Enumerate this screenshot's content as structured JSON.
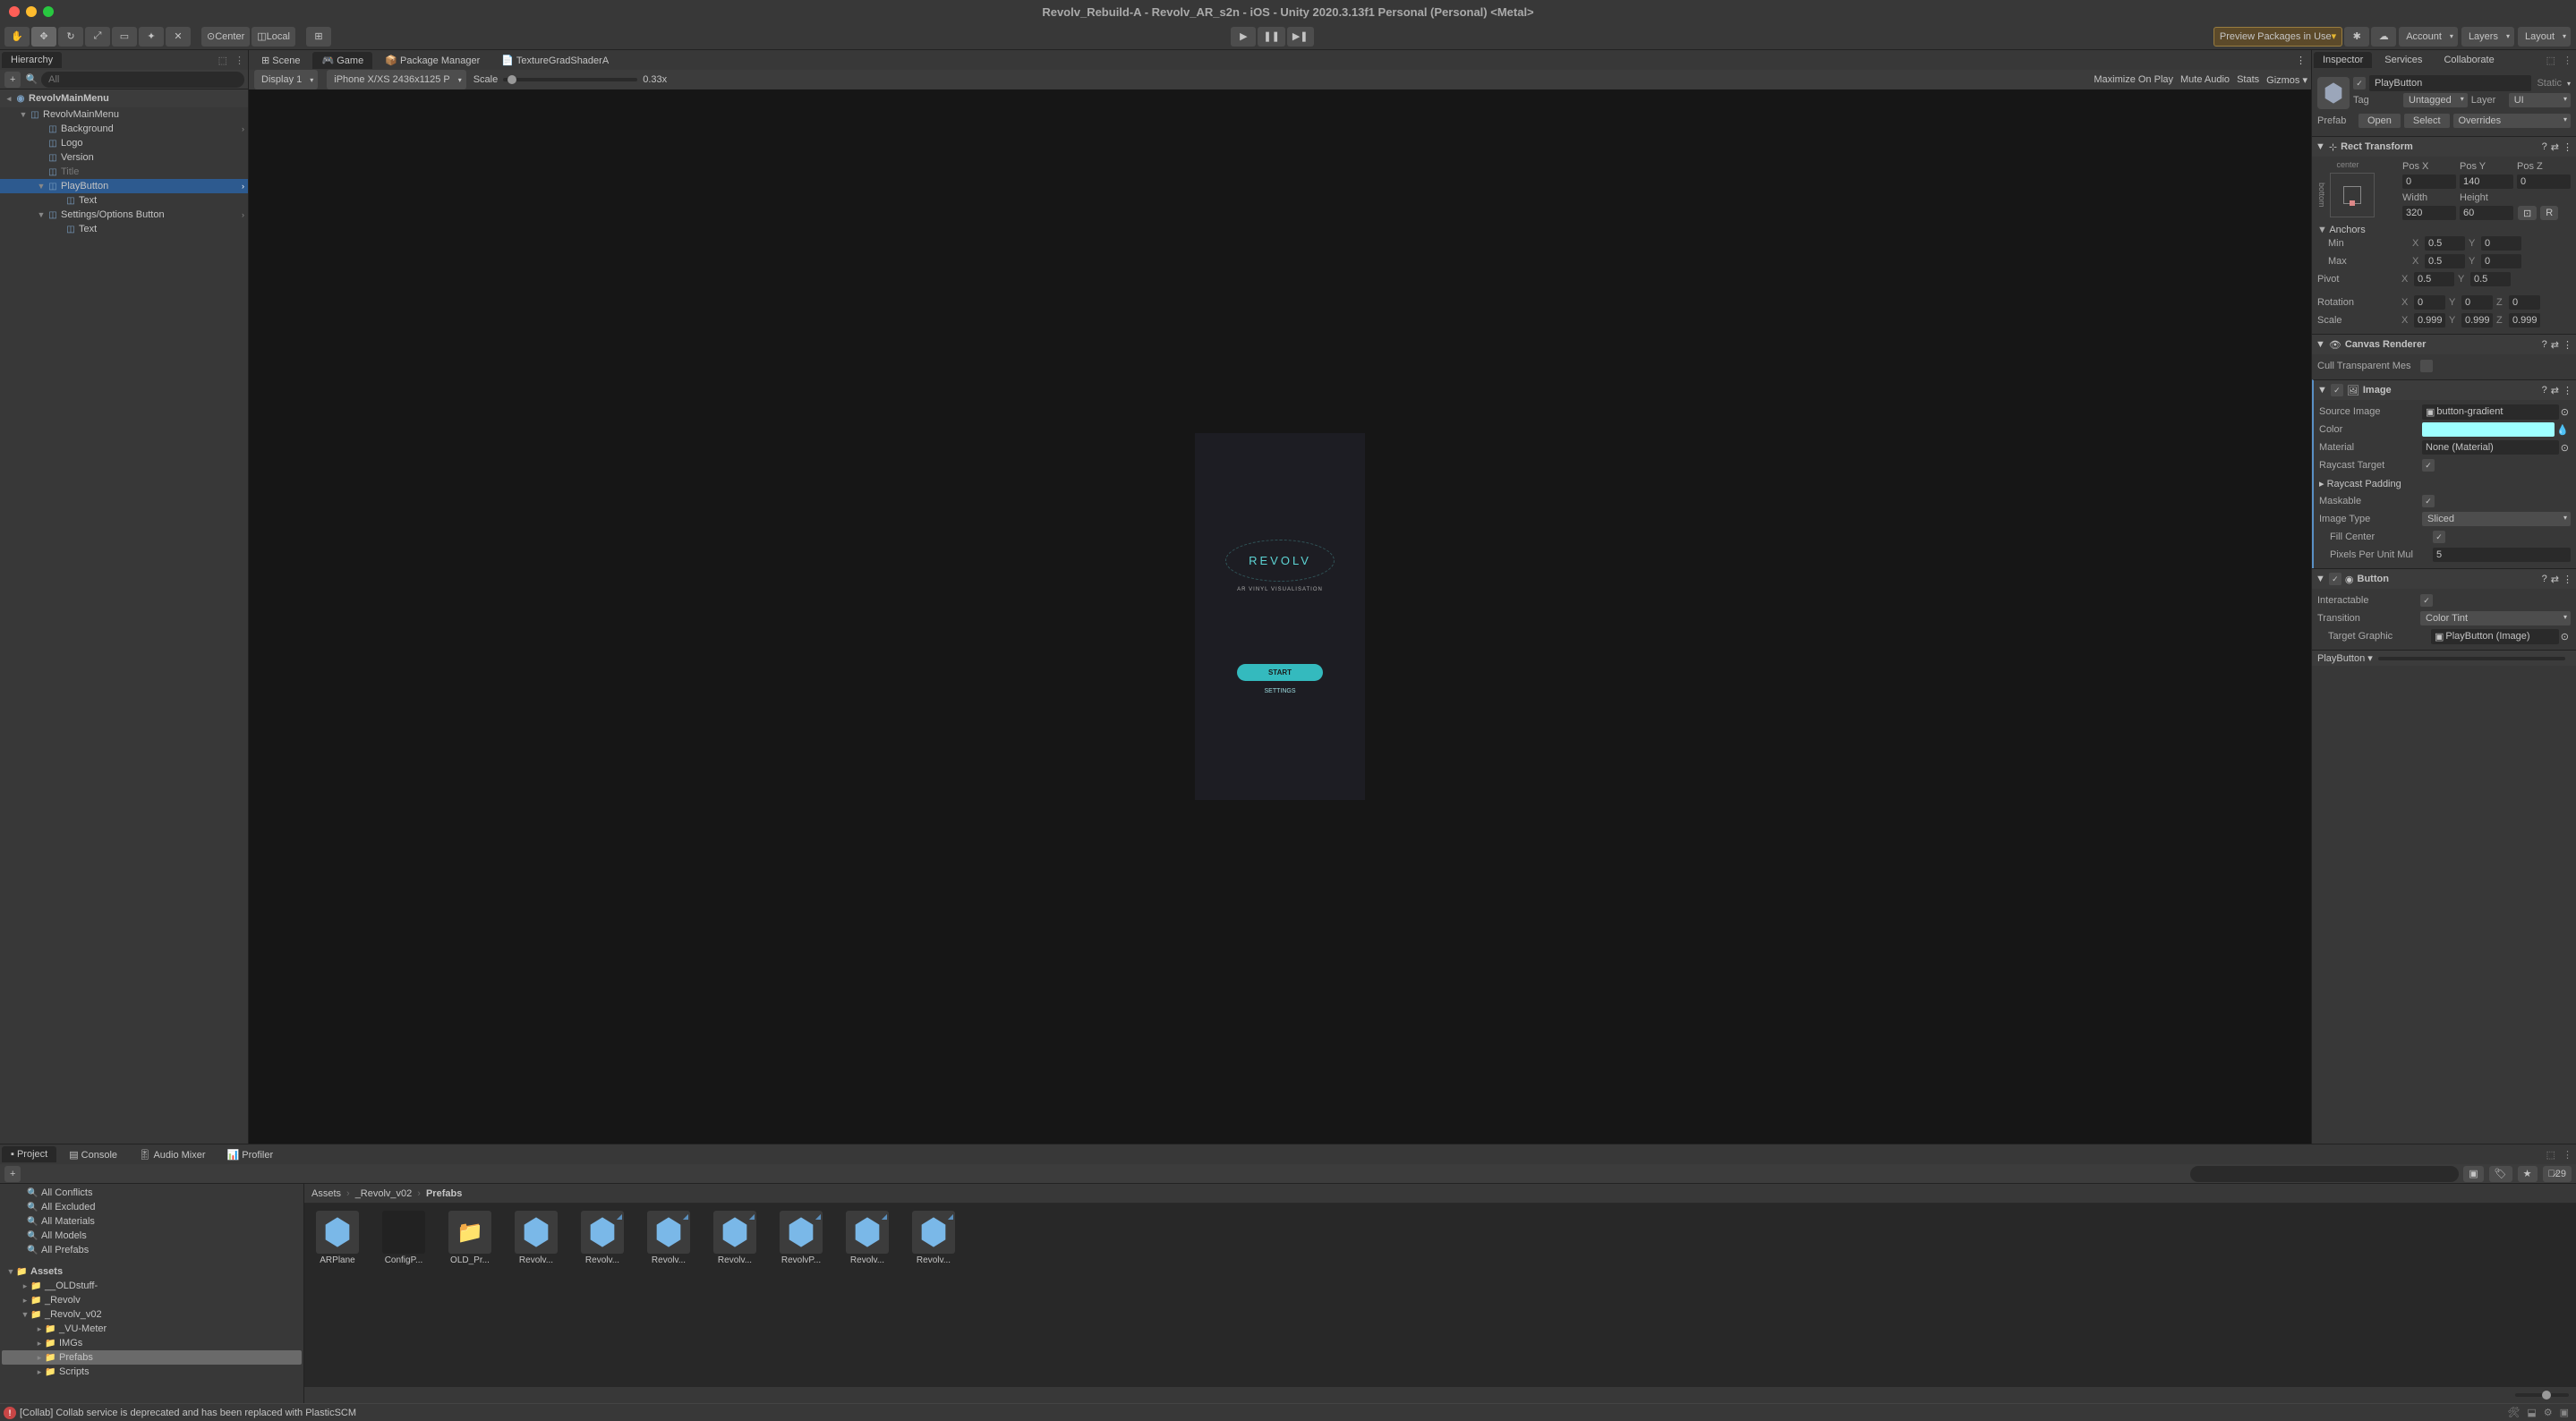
{
  "titlebar": {
    "title": "Revolv_Rebuild-A - Revolv_AR_s2n - iOS - Unity 2020.3.13f1 Personal (Personal) <Metal>"
  },
  "toolbar": {
    "pivot_label": "Center",
    "coord_label": "Local",
    "preview_packages": "Preview Packages in Use",
    "account": "Account",
    "layers": "Layers",
    "layout": "Layout"
  },
  "hierarchy": {
    "tab": "Hierarchy",
    "search_placeholder": "All",
    "scene_name": "RevolvMainMenu",
    "items": [
      {
        "name": "RevolvMainMenu",
        "indent": 1,
        "expanded": true,
        "has_children": true
      },
      {
        "name": "Background",
        "indent": 2,
        "arrow": true
      },
      {
        "name": "Logo",
        "indent": 2
      },
      {
        "name": "Version",
        "indent": 2
      },
      {
        "name": "Title",
        "indent": 2,
        "dim": true
      },
      {
        "name": "PlayButton",
        "indent": 2,
        "selected": true,
        "expanded": true,
        "arrow": true
      },
      {
        "name": "Text",
        "indent": 3
      },
      {
        "name": "Settings/Options Button",
        "indent": 2,
        "expanded": true,
        "arrow": true
      },
      {
        "name": "Text",
        "indent": 3
      }
    ]
  },
  "scene_tabs": {
    "scene": "Scene",
    "game": "Game",
    "package_manager": "Package Manager",
    "texture_grad": "TextureGradShaderA"
  },
  "game_toolbar": {
    "display": "Display 1",
    "resolution": "iPhone X/XS 2436x1125 P",
    "scale_label": "Scale",
    "scale_value": "0.33x",
    "maximize": "Maximize On Play",
    "mute": "Mute Audio",
    "stats": "Stats",
    "gizmos": "Gizmos"
  },
  "game_preview": {
    "logo": "REVOLV",
    "tagline": "AR VINYL VISUALISATION",
    "start_btn": "START",
    "settings_btn": "SETTINGS"
  },
  "inspector": {
    "tab": "Inspector",
    "tab_services": "Services",
    "tab_collaborate": "Collaborate",
    "name": "PlayButton",
    "static": "Static",
    "tag_label": "Tag",
    "tag_value": "Untagged",
    "layer_label": "Layer",
    "layer_value": "UI",
    "prefab_label": "Prefab",
    "open": "Open",
    "select": "Select",
    "overrides": "Overrides",
    "rect_transform": {
      "title": "Rect Transform",
      "anchor_preset_h": "center",
      "anchor_preset_v": "bottom",
      "posx_label": "Pos X",
      "posy_label": "Pos Y",
      "posz_label": "Pos Z",
      "posx": "0",
      "posy": "140",
      "posz": "0",
      "width_label": "Width",
      "height_label": "Height",
      "width": "320",
      "height": "60",
      "anchors_label": "Anchors",
      "min_label": "Min",
      "max_label": "Max",
      "pivot_label": "Pivot",
      "min_x": "0.5",
      "min_y": "0",
      "max_x": "0.5",
      "max_y": "0",
      "pivot_x": "0.5",
      "pivot_y": "0.5",
      "rotation_label": "Rotation",
      "rot_x": "0",
      "rot_y": "0",
      "rot_z": "0",
      "scale_label": "Scale",
      "scale_x": "0.9999",
      "scale_y": "0.9999",
      "scale_z": "0.9999"
    },
    "canvas_renderer": {
      "title": "Canvas Renderer",
      "cull_label": "Cull Transparent Mes"
    },
    "image": {
      "title": "Image",
      "source_label": "Source Image",
      "source_value": "button-gradient",
      "color_label": "Color",
      "material_label": "Material",
      "material_value": "None (Material)",
      "raycast_target_label": "Raycast Target",
      "raycast_padding_label": "Raycast Padding",
      "maskable_label": "Maskable",
      "image_type_label": "Image Type",
      "image_type_value": "Sliced",
      "fill_center_label": "Fill Center",
      "pixels_per_unit_label": "Pixels Per Unit Mul",
      "pixels_per_unit_value": "5"
    },
    "button": {
      "title": "Button",
      "interactable_label": "Interactable",
      "transition_label": "Transition",
      "transition_value": "Color Tint",
      "target_graphic_label": "Target Graphic",
      "target_graphic_value": "PlayButton (Image)",
      "footer": "PlayButton"
    }
  },
  "project": {
    "tabs": {
      "project": "Project",
      "console": "Console",
      "audio_mixer": "Audio Mixer",
      "profiler": "Profiler"
    },
    "hidden_count": "29",
    "filters": [
      {
        "label": "All Conflicts"
      },
      {
        "label": "All Excluded"
      },
      {
        "label": "All Materials"
      },
      {
        "label": "All Models"
      },
      {
        "label": "All Prefabs"
      }
    ],
    "assets_label": "Assets",
    "folders": [
      {
        "name": "__OLDstuff-",
        "indent": 1
      },
      {
        "name": "_Revolv",
        "indent": 1
      },
      {
        "name": "_Revolv_v02",
        "indent": 1,
        "expanded": true
      },
      {
        "name": "_VU-Meter",
        "indent": 2
      },
      {
        "name": "IMGs",
        "indent": 2
      },
      {
        "name": "Prefabs",
        "indent": 2,
        "selected": true
      },
      {
        "name": "Scripts",
        "indent": 2
      }
    ],
    "breadcrumb": [
      "Assets",
      "_Revolv_v02",
      "Prefabs"
    ],
    "assets": [
      {
        "name": "ARPlane",
        "type": "prefab"
      },
      {
        "name": "ConfigP...",
        "type": "dark"
      },
      {
        "name": "OLD_Pr...",
        "type": "folder"
      },
      {
        "name": "Revolv...",
        "type": "prefab"
      },
      {
        "name": "Revolv...",
        "type": "variant"
      },
      {
        "name": "Revolv...",
        "type": "variant"
      },
      {
        "name": "Revolv...",
        "type": "variant"
      },
      {
        "name": "RevolvP...",
        "type": "variant"
      },
      {
        "name": "Revolv...",
        "type": "variant"
      },
      {
        "name": "Revolv...",
        "type": "variant"
      }
    ]
  },
  "statusbar": {
    "error": "[Collab] Collab service is deprecated and has been replaced with PlasticSCM"
  }
}
